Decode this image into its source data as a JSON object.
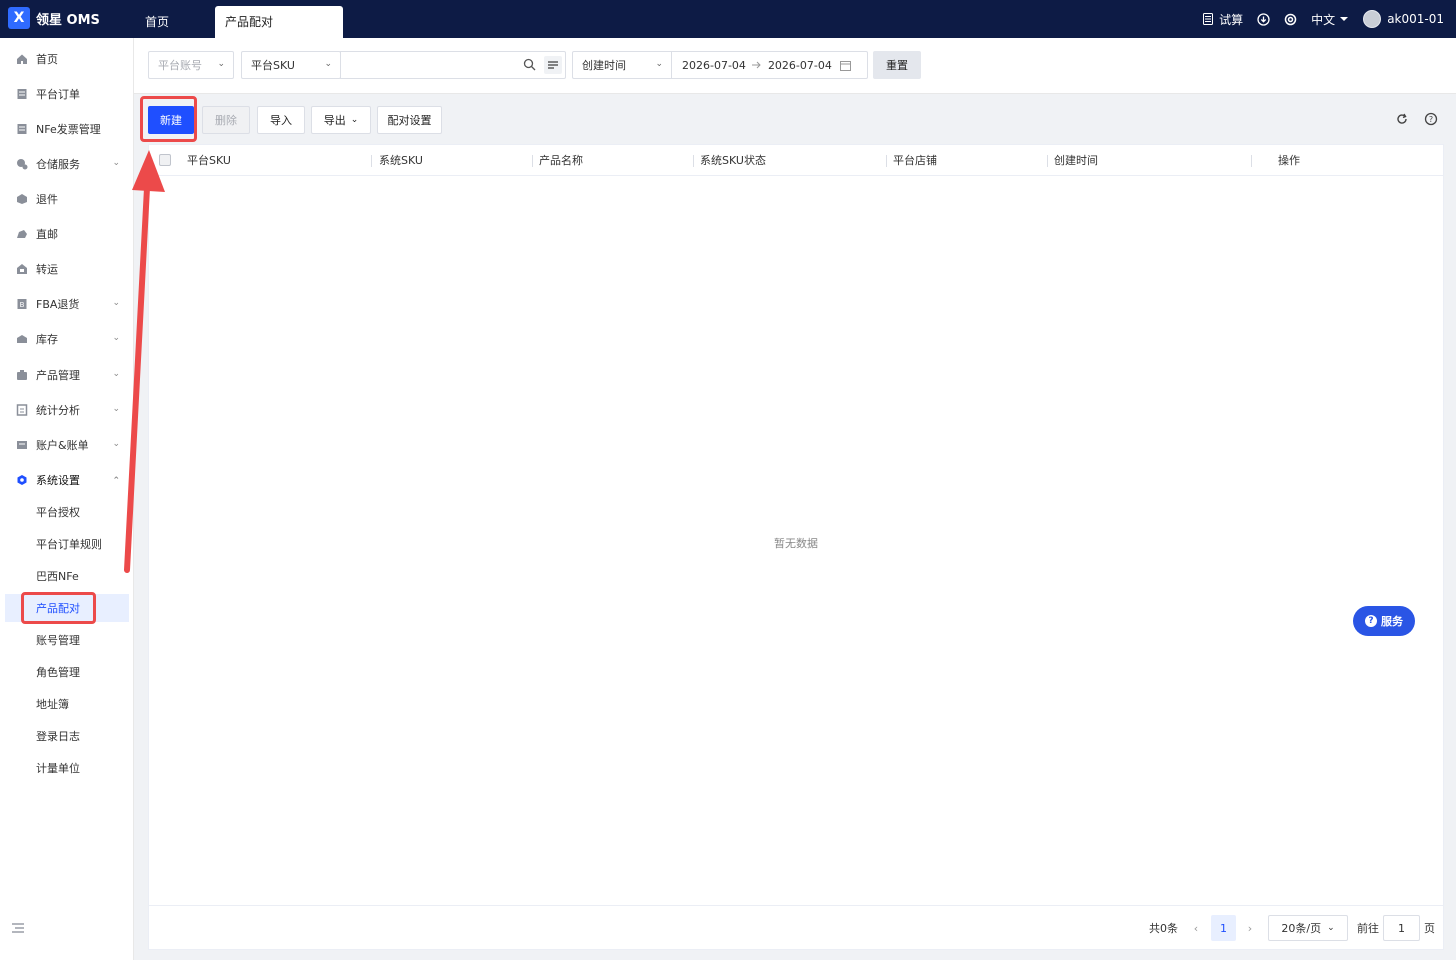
{
  "app": {
    "logo_text": "领星 OMS",
    "logo_letter": "X"
  },
  "tabs": [
    {
      "label": "首页"
    },
    {
      "label": "产品配对"
    }
  ],
  "topbar": {
    "trial": "试算",
    "language": "中文",
    "user": "ak001-01"
  },
  "sidebar": {
    "items": [
      {
        "label": "首页"
      },
      {
        "label": "平台订单"
      },
      {
        "label": "NFe发票管理"
      },
      {
        "label": "仓储服务"
      },
      {
        "label": "退件"
      },
      {
        "label": "直邮"
      },
      {
        "label": "转运"
      },
      {
        "label": "FBA退货"
      },
      {
        "label": "库存"
      },
      {
        "label": "产品管理"
      },
      {
        "label": "统计分析"
      },
      {
        "label": "账户&账单"
      },
      {
        "label": "系统设置"
      }
    ],
    "sub_items": [
      {
        "label": "平台授权"
      },
      {
        "label": "平台订单规则"
      },
      {
        "label": "巴西NFe"
      },
      {
        "label": "产品配对"
      },
      {
        "label": "账号管理"
      },
      {
        "label": "角色管理"
      },
      {
        "label": "地址簿"
      },
      {
        "label": "登录日志"
      },
      {
        "label": "计量单位"
      }
    ]
  },
  "filters": {
    "platform_account_placeholder": "平台账号",
    "sku_type": "平台SKU",
    "search_value": "",
    "time_type": "创建时间",
    "date_start": "2026-07-04",
    "date_end": "2026-07-04",
    "reset": "重置"
  },
  "toolbar": {
    "new": "新建",
    "delete": "删除",
    "import": "导入",
    "export": "导出",
    "pair_settings": "配对设置"
  },
  "table": {
    "columns": [
      "平台SKU",
      "系统SKU",
      "产品名称",
      "系统SKU状态",
      "平台店铺",
      "创建时间",
      "操作"
    ],
    "empty_text": "暂无数据"
  },
  "pagination": {
    "total": "共0条",
    "current_page": "1",
    "page_size": "20条/页",
    "goto_label": "前往",
    "goto_value": "1",
    "page_unit": "页"
  },
  "service": {
    "label": "服务"
  },
  "colors": {
    "brand": "#0d1b45",
    "accent": "#1f4fff",
    "highlight": "#ec4a4a"
  }
}
